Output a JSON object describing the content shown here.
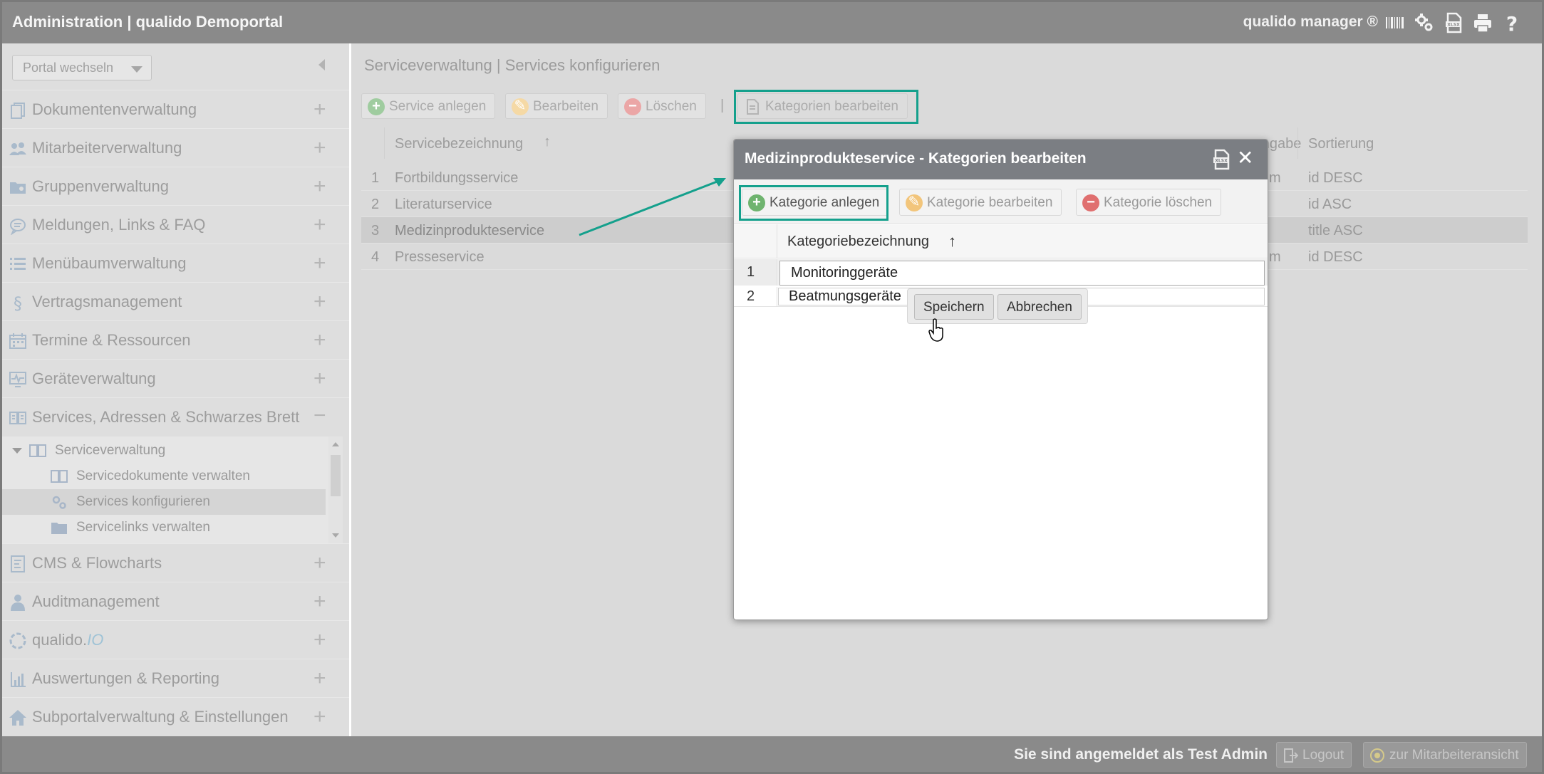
{
  "header": {
    "app_title": "Administration | qualido Demoportal",
    "product": "qualido manager ®",
    "icons": [
      "barcode-icon",
      "settings-cog-icon",
      "xlsx-export-icon",
      "print-icon",
      "help-icon"
    ]
  },
  "sidebar": {
    "portal_select": "Portal wechseln",
    "items": [
      {
        "label": "Dokumentenverwaltung",
        "icon": "documents-icon"
      },
      {
        "label": "Mitarbeiterverwaltung",
        "icon": "users-icon"
      },
      {
        "label": "Gruppenverwaltung",
        "icon": "group-folder-icon"
      },
      {
        "label": "Meldungen, Links & FAQ",
        "icon": "chat-bubble-icon"
      },
      {
        "label": "Menübaumverwaltung",
        "icon": "list-icon"
      },
      {
        "label": "Vertragsmanagement",
        "icon": "paragraph-icon"
      },
      {
        "label": "Termine & Ressourcen",
        "icon": "calendar-icon"
      },
      {
        "label": "Geräteverwaltung",
        "icon": "monitor-pulse-icon"
      },
      {
        "label": "Services, Adressen & Schwarzes Brett",
        "icon": "book-icon"
      },
      {
        "label": "CMS & Flowcharts",
        "icon": "cms-icon"
      },
      {
        "label": "Auditmanagement",
        "icon": "auditor-icon"
      },
      {
        "label": "qualido.",
        "label_suffix": "IO",
        "icon": "refresh-circle-icon"
      },
      {
        "label": "Auswertungen & Reporting",
        "icon": "bar-chart-icon"
      },
      {
        "label": "Subportalverwaltung & Einstellungen",
        "icon": "home-icon"
      }
    ],
    "subtree": {
      "parent": "Serviceverwaltung",
      "children": [
        "Servicedokumente verwalten",
        "Services konfigurieren",
        "Servicelinks verwalten"
      ]
    }
  },
  "main": {
    "breadcrumb": "Serviceverwaltung | Services konfigurieren",
    "toolbar": {
      "add": "Service anlegen",
      "edit": "Bearbeiten",
      "delete": "Löschen",
      "separator": "|",
      "categories": "Kategorien bearbeiten"
    },
    "table": {
      "columns": [
        "Servicebezeichnung",
        "msangabe",
        "Sortierung"
      ],
      "sort_indicator": "↑",
      "rows": [
        {
          "num": "1",
          "name": "Fortbildungsservice",
          "datum": "m",
          "sort": "id DESC"
        },
        {
          "num": "2",
          "name": "Literaturservice",
          "datum": "",
          "sort": "id ASC"
        },
        {
          "num": "3",
          "name": "Medizinprodukteservice",
          "datum": "",
          "sort": "title ASC"
        },
        {
          "num": "4",
          "name": "Presseservice",
          "datum": "m",
          "sort": "id DESC"
        }
      ]
    }
  },
  "dialog": {
    "title": "Medizinprodukteservice - Kategorien bearbeiten",
    "toolbar": {
      "add": "Kategorie anlegen",
      "edit": "Kategorie bearbeiten",
      "delete": "Kategorie löschen"
    },
    "column": "Kategoriebezeichnung",
    "sort_indicator": "↑",
    "rows": [
      {
        "num": "1",
        "value": "Monitoringgeräte"
      },
      {
        "num": "2",
        "value": "Beatmungsgeräte"
      }
    ],
    "row_editor": {
      "save": "Speichern",
      "cancel": "Abbrechen"
    }
  },
  "footer": {
    "login_text": "Sie sind angemeldet als Test Admin",
    "logout": "Logout",
    "employee_view": "zur Mitarbeiteransicht"
  },
  "colors": {
    "highlight": "#14a08c",
    "header_bg": "#8a8a8a",
    "add_green": "#79b879",
    "edit_orange": "#f0c77a",
    "delete_red": "#e07373"
  }
}
